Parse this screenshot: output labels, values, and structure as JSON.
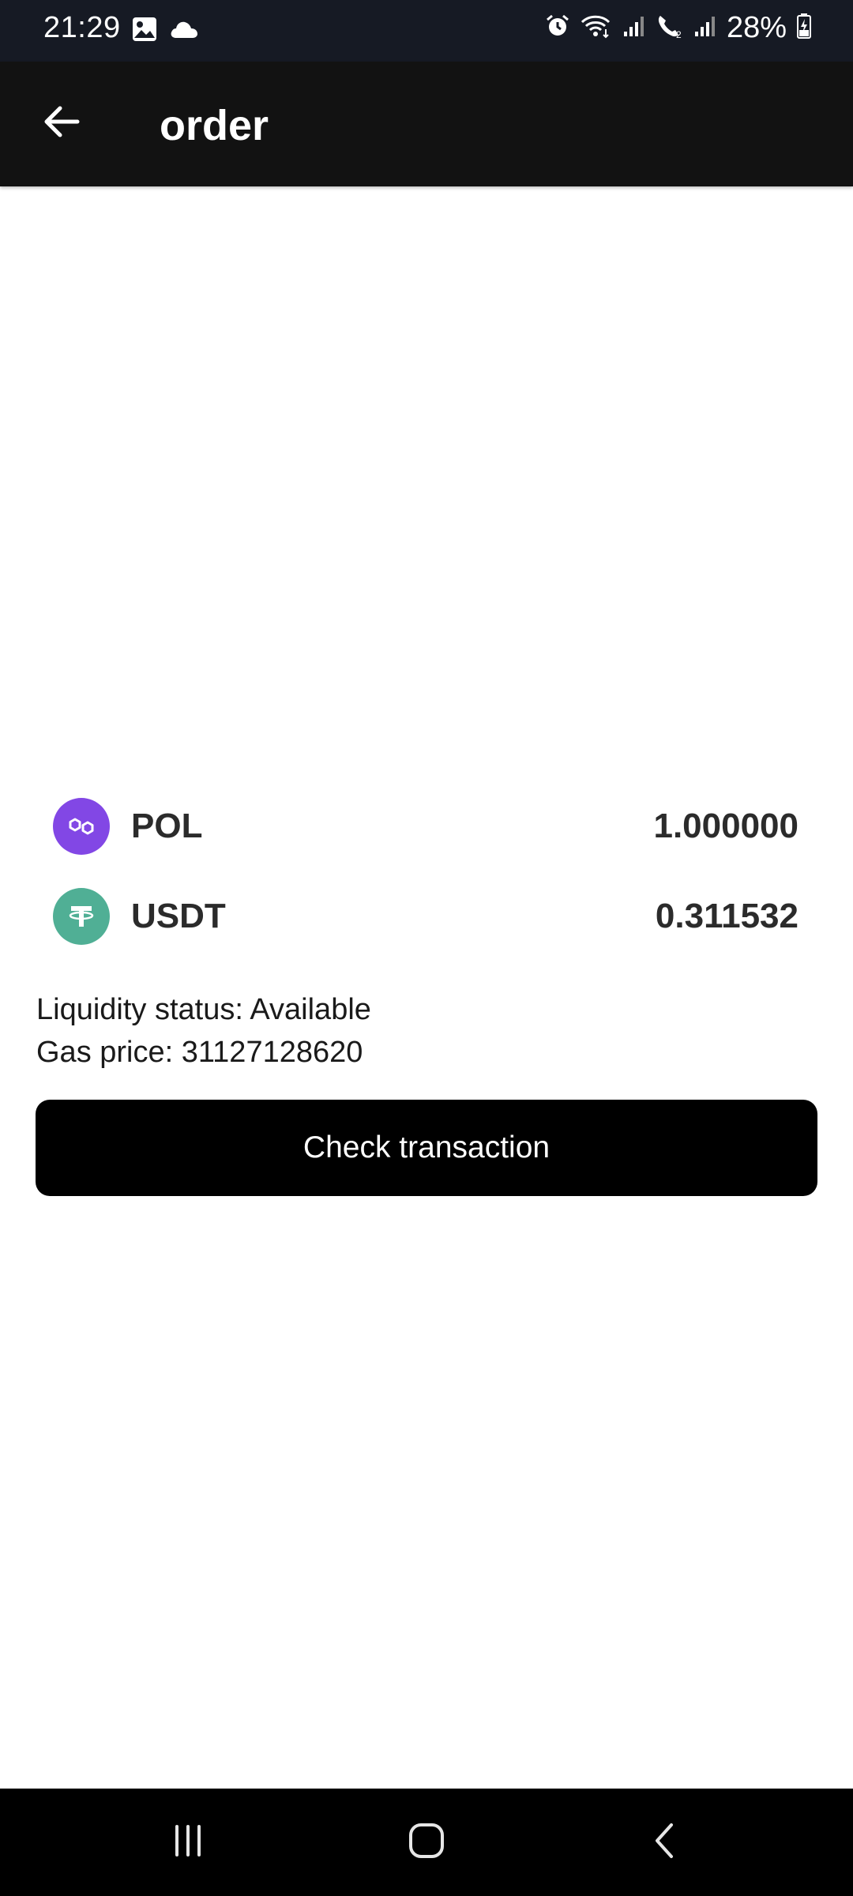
{
  "status_bar": {
    "time": "21:29",
    "battery": "28%",
    "icons": [
      "image-icon",
      "cloud-icon",
      "alarm-icon",
      "wifi-icon",
      "signal-icon",
      "call-icon",
      "signal-icon",
      "battery-charging-icon"
    ]
  },
  "app_bar": {
    "title": "order",
    "back_icon": "arrow-left-icon"
  },
  "tokens": [
    {
      "symbol": "POL",
      "amount": "1.000000",
      "icon": "polygon-icon",
      "color": "#8247e5"
    },
    {
      "symbol": "USDT",
      "amount": "0.311532",
      "icon": "tether-icon",
      "color": "#50af95"
    }
  ],
  "info": {
    "liquidity": "Liquidity status: Available",
    "gas_price": "Gas price: 31127128620"
  },
  "actions": {
    "check_transaction": "Check transaction"
  },
  "nav": {
    "icons": [
      "recent-apps-icon",
      "home-icon",
      "back-icon"
    ]
  }
}
